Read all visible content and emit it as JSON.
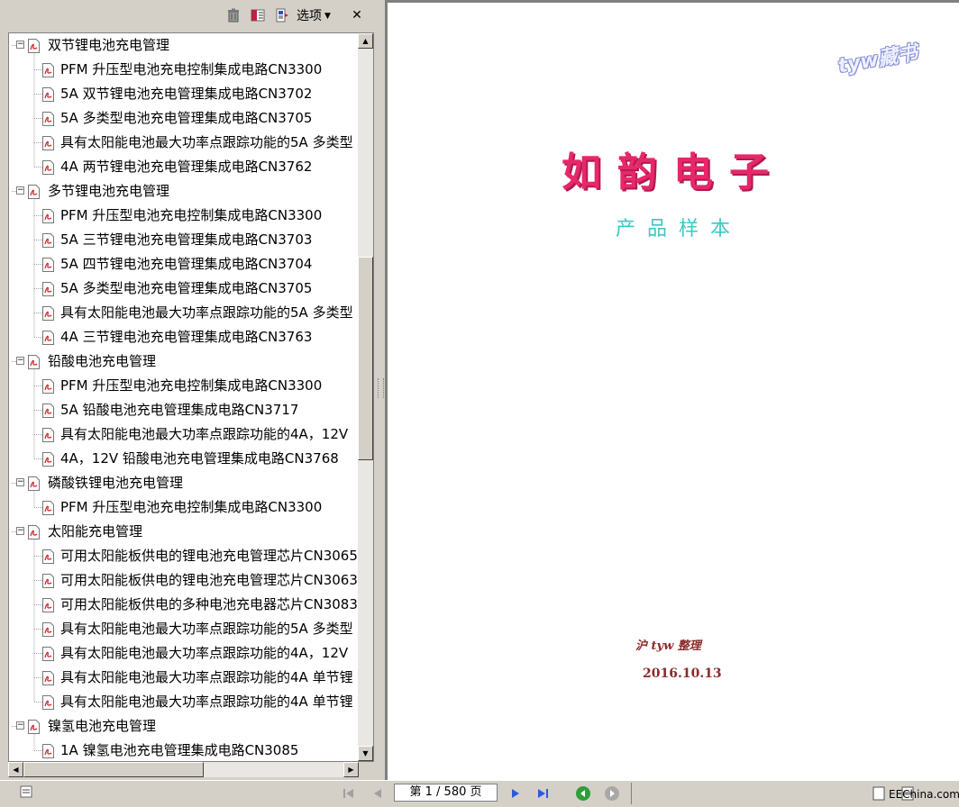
{
  "panel": {
    "toolbar": {
      "delete_icon": "trash-icon",
      "expand_icon": "bookmark-expand-icon",
      "options_icon": "bookmark-options-icon",
      "options_label": "选项",
      "close_glyph": "✕"
    },
    "bookmarks": [
      {
        "level": 0,
        "label": "双节锂电池充电管理",
        "expanded": true
      },
      {
        "level": 1,
        "label": "PFM 升压型电池充电控制集成电路CN3300"
      },
      {
        "level": 1,
        "label": "5A 双节锂电池充电管理集成电路CN3702"
      },
      {
        "level": 1,
        "label": "5A 多类型电池充电管理集成电路CN3705"
      },
      {
        "level": 1,
        "label": "具有太阳能电池最大功率点跟踪功能的5A 多类型"
      },
      {
        "level": 1,
        "label": "4A 两节锂电池充电管理集成电路CN3762"
      },
      {
        "level": 0,
        "label": "多节锂电池充电管理",
        "expanded": true
      },
      {
        "level": 1,
        "label": "PFM 升压型电池充电控制集成电路CN3300"
      },
      {
        "level": 1,
        "label": "5A 三节锂电池充电管理集成电路CN3703"
      },
      {
        "level": 1,
        "label": "5A 四节锂电池充电管理集成电路CN3704"
      },
      {
        "level": 1,
        "label": "5A 多类型电池充电管理集成电路CN3705"
      },
      {
        "level": 1,
        "label": "具有太阳能电池最大功率点跟踪功能的5A 多类型"
      },
      {
        "level": 1,
        "label": "4A 三节锂电池充电管理集成电路CN3763"
      },
      {
        "level": 0,
        "label": "铅酸电池充电管理",
        "expanded": true
      },
      {
        "level": 1,
        "label": "PFM 升压型电池充电控制集成电路CN3300"
      },
      {
        "level": 1,
        "label": "5A 铅酸电池充电管理集成电路CN3717"
      },
      {
        "level": 1,
        "label": "具有太阳能电池最大功率点跟踪功能的4A，12V"
      },
      {
        "level": 1,
        "label": "4A，12V 铅酸电池充电管理集成电路CN3768"
      },
      {
        "level": 0,
        "label": "磷酸铁锂电池充电管理",
        "expanded": true
      },
      {
        "level": 1,
        "label": "PFM 升压型电池充电控制集成电路CN3300"
      },
      {
        "level": 0,
        "label": "太阳能充电管理",
        "expanded": true
      },
      {
        "level": 1,
        "label": "可用太阳能板供电的锂电池充电管理芯片CN3065"
      },
      {
        "level": 1,
        "label": "可用太阳能板供电的锂电池充电管理芯片CN3063"
      },
      {
        "level": 1,
        "label": "可用太阳能板供电的多种电池充电器芯片CN3083"
      },
      {
        "level": 1,
        "label": "具有太阳能电池最大功率点跟踪功能的5A 多类型"
      },
      {
        "level": 1,
        "label": "具有太阳能电池最大功率点跟踪功能的4A，12V"
      },
      {
        "level": 1,
        "label": "具有太阳能电池最大功率点跟踪功能的4A 单节锂"
      },
      {
        "level": 1,
        "label": "具有太阳能电池最大功率点跟踪功能的4A 单节锂"
      },
      {
        "level": 0,
        "label": "镍氢电池充电管理",
        "expanded": true
      },
      {
        "level": 1,
        "label": "1A 镍氢电池充电管理集成电路CN3085"
      }
    ],
    "scroll": {
      "vertical_fraction": 0.3,
      "horizontal_fraction": 0.0
    }
  },
  "document": {
    "watermark": "tyw藏书",
    "brand": "如韵电子",
    "subtitle": "产品样本",
    "organizer": "沪 tyw 整理",
    "date": "2016.10.13"
  },
  "statusbar": {
    "page_indicator": "第 1 / 580 页",
    "current_page": 1,
    "total_pages": 580,
    "logo": "EEChina.com"
  },
  "colors": {
    "brand": "#e6286a",
    "subtitle": "#3cc8c4",
    "footer_text": "#8b2a2a",
    "panel_bg": "#d4d0c8"
  }
}
